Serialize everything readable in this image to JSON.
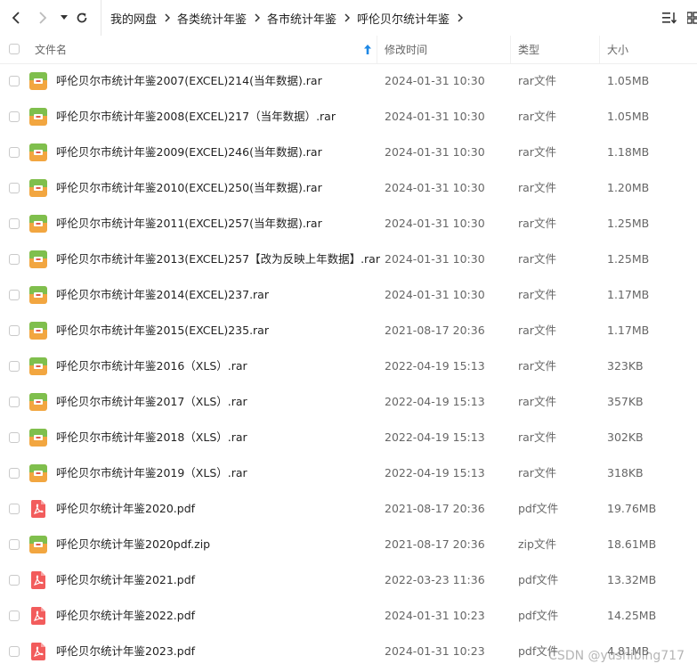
{
  "breadcrumb": [
    "我的网盘",
    "各类统计年鉴",
    "各市统计年鉴",
    "呼伦贝尔统计年鉴"
  ],
  "header": {
    "name": "文件名",
    "modified": "修改时间",
    "type": "类型",
    "size": "大小"
  },
  "files": [
    {
      "name": "呼伦贝尔市统计年鉴2007(EXCEL)214(当年数据).rar",
      "modified": "2024-01-31 10:30",
      "type": "rar文件",
      "size": "1.05MB",
      "icon": "archive"
    },
    {
      "name": "呼伦贝尔市统计年鉴2008(EXCEL)217（当年数据）.rar",
      "modified": "2024-01-31 10:30",
      "type": "rar文件",
      "size": "1.05MB",
      "icon": "archive"
    },
    {
      "name": "呼伦贝尔市统计年鉴2009(EXCEL)246(当年数据).rar",
      "modified": "2024-01-31 10:30",
      "type": "rar文件",
      "size": "1.18MB",
      "icon": "archive"
    },
    {
      "name": "呼伦贝尔市统计年鉴2010(EXCEL)250(当年数据).rar",
      "modified": "2024-01-31 10:30",
      "type": "rar文件",
      "size": "1.20MB",
      "icon": "archive"
    },
    {
      "name": "呼伦贝尔市统计年鉴2011(EXCEL)257(当年数据).rar",
      "modified": "2024-01-31 10:30",
      "type": "rar文件",
      "size": "1.25MB",
      "icon": "archive"
    },
    {
      "name": "呼伦贝尔市统计年鉴2013(EXCEL)257【改为反映上年数据】.rar",
      "modified": "2024-01-31 10:30",
      "type": "rar文件",
      "size": "1.25MB",
      "icon": "archive"
    },
    {
      "name": "呼伦贝尔市统计年鉴2014(EXCEL)237.rar",
      "modified": "2024-01-31 10:30",
      "type": "rar文件",
      "size": "1.17MB",
      "icon": "archive"
    },
    {
      "name": "呼伦贝尔市统计年鉴2015(EXCEL)235.rar",
      "modified": "2021-08-17 20:36",
      "type": "rar文件",
      "size": "1.17MB",
      "icon": "archive"
    },
    {
      "name": "呼伦贝尔市统计年鉴2016（XLS）.rar",
      "modified": "2022-04-19 15:13",
      "type": "rar文件",
      "size": "323KB",
      "icon": "archive"
    },
    {
      "name": "呼伦贝尔市统计年鉴2017（XLS）.rar",
      "modified": "2022-04-19 15:13",
      "type": "rar文件",
      "size": "357KB",
      "icon": "archive"
    },
    {
      "name": "呼伦贝尔市统计年鉴2018（XLS）.rar",
      "modified": "2022-04-19 15:13",
      "type": "rar文件",
      "size": "302KB",
      "icon": "archive"
    },
    {
      "name": "呼伦贝尔市统计年鉴2019（XLS）.rar",
      "modified": "2022-04-19 15:13",
      "type": "rar文件",
      "size": "318KB",
      "icon": "archive"
    },
    {
      "name": "呼伦贝尔统计年鉴2020.pdf",
      "modified": "2021-08-17 20:36",
      "type": "pdf文件",
      "size": "19.76MB",
      "icon": "pdf"
    },
    {
      "name": "呼伦贝尔统计年鉴2020pdf.zip",
      "modified": "2021-08-17 20:36",
      "type": "zip文件",
      "size": "18.61MB",
      "icon": "archive"
    },
    {
      "name": "呼伦贝尔统计年鉴2021.pdf",
      "modified": "2022-03-23 11:36",
      "type": "pdf文件",
      "size": "13.32MB",
      "icon": "pdf"
    },
    {
      "name": "呼伦贝尔统计年鉴2022.pdf",
      "modified": "2024-01-31 10:23",
      "type": "pdf文件",
      "size": "14.25MB",
      "icon": "pdf"
    },
    {
      "name": "呼伦贝尔统计年鉴2023.pdf",
      "modified": "2024-01-31 10:23",
      "type": "pdf文件",
      "size": "4.81MB",
      "icon": "pdf"
    }
  ],
  "watermark": "CSDN @yushibing717",
  "colors": {
    "sort_arrow": "#1e88e5",
    "pdf_icon": "#f25c5c",
    "archive_top": "#7fbf4d",
    "archive_bottom": "#f2a640"
  }
}
